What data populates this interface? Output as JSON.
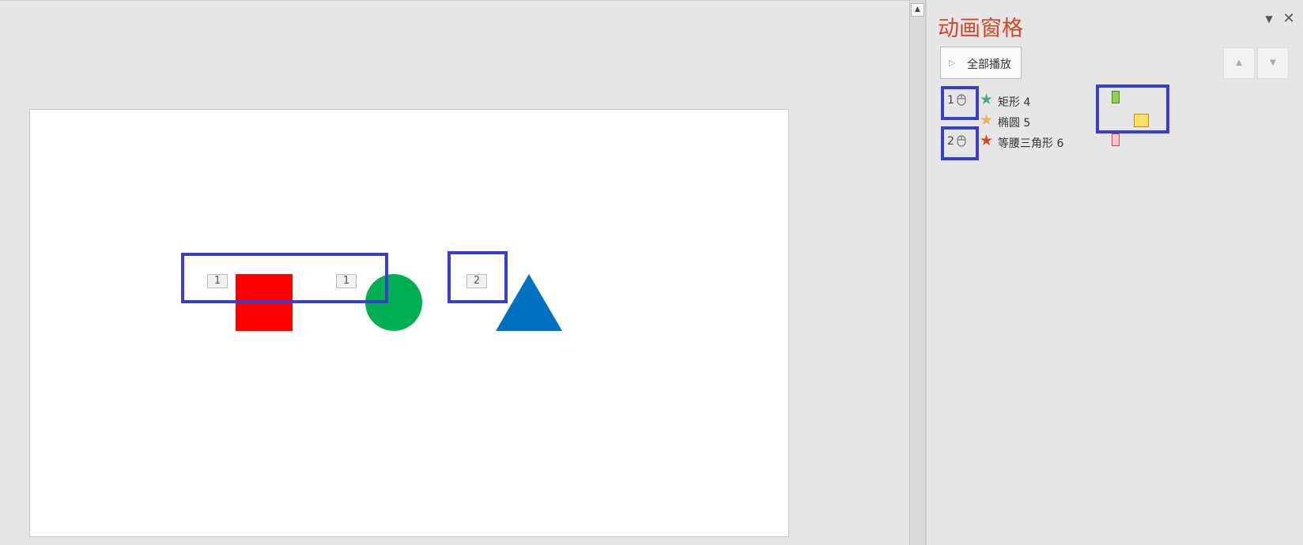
{
  "slide": {
    "shapes": [
      {
        "name": "矩形 4",
        "color": "#ff0000"
      },
      {
        "name": "椭圆 5",
        "color": "#00b050"
      },
      {
        "name": "等腰三角形 6",
        "color": "#0070c0"
      }
    ],
    "tags": {
      "rect": "1",
      "ellipse": "1",
      "triangle": "2"
    }
  },
  "scrollbar": {
    "up_icon": "▲"
  },
  "pane": {
    "title": "动画窗格",
    "menu_icon": "▼",
    "close_icon": "✕",
    "play_all_icon": "▷",
    "play_all_label": "全部播放",
    "move_up_icon": "▲",
    "move_down_icon": "▼",
    "rows": [
      {
        "order": "1",
        "name": "矩形 4",
        "star_color": "#4ea58a",
        "bar_color": "#92d050",
        "bar_border": "#548235"
      },
      {
        "order": "",
        "name": "椭圆 5",
        "star_color": "#e6b55c",
        "bar_color": "#ffe066",
        "bar_border": "#bf9000"
      },
      {
        "order": "2",
        "name": "等腰三角形 6",
        "star_color": "#d0492c",
        "bar_color": "#ffc7ce",
        "bar_border": "#c0504d"
      }
    ]
  },
  "colors": {
    "highlight": "#3b3fc8",
    "accent": "#d24726"
  }
}
